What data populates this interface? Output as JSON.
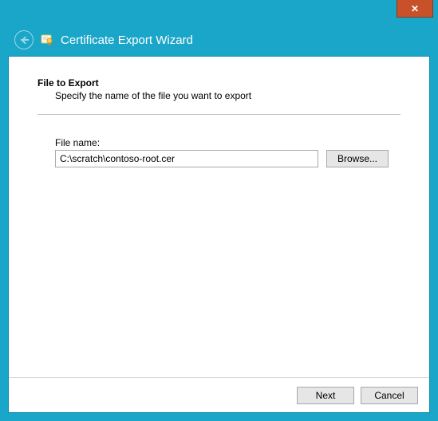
{
  "titlebar": {
    "close_label": "✕"
  },
  "header": {
    "wizard_title": "Certificate Export Wizard"
  },
  "section": {
    "heading": "File to Export",
    "subheading": "Specify the name of the file you want to export"
  },
  "form": {
    "file_label": "File name:",
    "file_value": "C:\\scratch\\contoso-root.cer",
    "browse_label": "Browse..."
  },
  "footer": {
    "next_label": "Next",
    "cancel_label": "Cancel"
  }
}
